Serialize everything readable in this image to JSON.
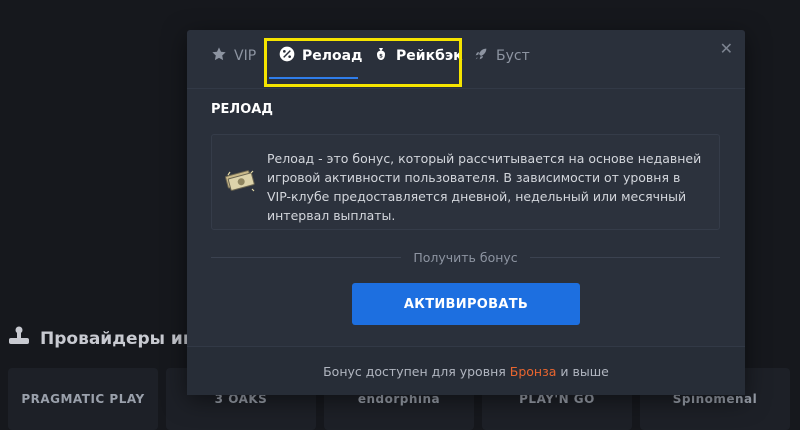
{
  "background": {
    "section_title": "Провайдеры игр",
    "providers": [
      "PRAGMATIC PLAY",
      "3 OAKS",
      "endorphina",
      "PLAY'N GO",
      "Spinomenal"
    ]
  },
  "modal": {
    "tabs": [
      {
        "label": "VIP",
        "icon": "star-icon"
      },
      {
        "label": "Релоад",
        "icon": "percent-badge-icon",
        "active": true
      },
      {
        "label": "Рейкбэк",
        "icon": "money-bag-icon"
      },
      {
        "label": "Буст",
        "icon": "rocket-icon"
      }
    ],
    "section_title": "РЕЛОАД",
    "description": "Релоад - это бонус, который рассчитывается на основе недавней игровой активности пользователя. В зависимости от уровня в VIP-клубе предоставляется дневной, недельный или месячный интервал выплаты.",
    "get_bonus_label": "Получить бонус",
    "activate_label": "АКТИВИРОВАТЬ",
    "footer": {
      "prefix": "Бонус доступен для уровня",
      "level": "Бронза",
      "suffix": "и выше"
    }
  },
  "colors": {
    "accent": "#1d6fe0",
    "highlight": "#f5e400",
    "level": "#e8652f"
  }
}
